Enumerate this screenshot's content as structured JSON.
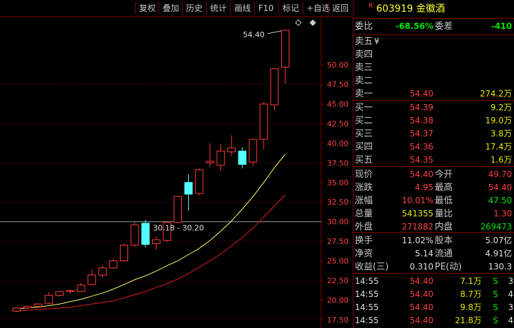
{
  "toolbar": {
    "buttons": [
      "复权",
      "叠加",
      "历史",
      "统计",
      "画线",
      "F10",
      "标记",
      "+自选",
      "返回"
    ]
  },
  "colors": {
    "up": "#ff3b3b",
    "down": "#54ffff",
    "ma_short": "#ffff66",
    "ma_long": "#e02020",
    "grid": "#800000",
    "axis_text": "#ff4040"
  },
  "chart_data": {
    "type": "candlestick",
    "y_ticks": [
      "50.00",
      "47.50",
      "45.00",
      "42.50",
      "40.00",
      "37.50",
      "35.00",
      "32.50",
      "30.00",
      "27.50",
      "25.00",
      "22.50",
      "20.00",
      "17.50"
    ],
    "ylim": [
      17.5,
      55
    ],
    "candles": [
      {
        "o": 18.6,
        "h": 19.1,
        "l": 18.5,
        "c": 19.0
      },
      {
        "o": 19.0,
        "h": 19.3,
        "l": 18.9,
        "c": 19.2
      },
      {
        "o": 19.2,
        "h": 19.6,
        "l": 19.1,
        "c": 19.5
      },
      {
        "o": 19.6,
        "h": 21.0,
        "l": 19.5,
        "c": 20.6
      },
      {
        "o": 20.6,
        "h": 21.2,
        "l": 20.5,
        "c": 21.1
      },
      {
        "o": 21.1,
        "h": 21.4,
        "l": 20.8,
        "c": 21.2
      },
      {
        "o": 21.1,
        "h": 22.2,
        "l": 21.0,
        "c": 21.9
      },
      {
        "o": 22.0,
        "h": 23.9,
        "l": 21.9,
        "c": 23.2
      },
      {
        "o": 23.2,
        "h": 24.4,
        "l": 22.9,
        "c": 24.1
      },
      {
        "o": 24.1,
        "h": 25.3,
        "l": 24.0,
        "c": 25.0
      },
      {
        "o": 25.0,
        "h": 27.2,
        "l": 24.9,
        "c": 27.0
      },
      {
        "o": 27.0,
        "h": 29.9,
        "l": 26.8,
        "c": 29.6
      },
      {
        "o": 29.8,
        "h": 30.2,
        "l": 26.7,
        "c": 27.1
      },
      {
        "o": 27.2,
        "h": 28.1,
        "l": 26.4,
        "c": 27.7
      },
      {
        "o": 27.6,
        "h": 30.0,
        "l": 27.4,
        "c": 29.9
      },
      {
        "o": 29.9,
        "h": 33.3,
        "l": 29.8,
        "c": 33.2
      },
      {
        "o": 35.0,
        "h": 36.0,
        "l": 31.4,
        "c": 33.5
      },
      {
        "o": 33.6,
        "h": 36.8,
        "l": 33.4,
        "c": 36.6
      },
      {
        "o": 37.5,
        "h": 40.0,
        "l": 37.0,
        "c": 37.7
      },
      {
        "o": 37.2,
        "h": 39.9,
        "l": 36.5,
        "c": 39.0
      },
      {
        "o": 38.9,
        "h": 41.0,
        "l": 38.4,
        "c": 39.4
      },
      {
        "o": 39.0,
        "h": 39.5,
        "l": 36.8,
        "c": 37.3
      },
      {
        "o": 37.6,
        "h": 40.6,
        "l": 37.1,
        "c": 40.5
      },
      {
        "o": 40.5,
        "h": 45.3,
        "l": 39.2,
        "c": 45.0
      },
      {
        "o": 44.9,
        "h": 49.6,
        "l": 44.2,
        "c": 49.5
      },
      {
        "o": 49.7,
        "h": 54.4,
        "l": 47.6,
        "c": 54.4
      }
    ],
    "ma5": [
      18.9,
      19.0,
      19.1,
      19.3,
      19.5,
      19.8,
      20.1,
      20.5,
      20.9,
      21.4,
      22.0,
      22.6,
      23.1,
      23.7,
      24.4,
      25.0,
      25.8,
      26.6,
      27.6,
      28.8,
      30.1,
      31.6,
      33.2,
      35.0,
      36.9,
      38.6
    ],
    "ma10": [
      18.6,
      18.7,
      18.8,
      18.9,
      19.0,
      19.1,
      19.3,
      19.5,
      19.7,
      19.9,
      20.3,
      20.7,
      21.1,
      21.6,
      22.1,
      22.7,
      23.4,
      24.2,
      25.0,
      25.9,
      26.9,
      28.0,
      29.2,
      30.6,
      32.0,
      33.4
    ],
    "ref_line": 30.0,
    "ref_label": "30.18 - 30.20",
    "max_label": "54.40"
  },
  "quote": {
    "badge": "R",
    "code_name": "603919 金徽酒",
    "webi_label": "委比",
    "webi_value": "-68.56%",
    "weicha_label": "委差",
    "weicha_value": "-410",
    "sell": [
      {
        "label": "卖五",
        "price": "",
        "vol": "",
        "extra": "¥"
      },
      {
        "label": "卖四",
        "price": "",
        "vol": ""
      },
      {
        "label": "卖三",
        "price": "",
        "vol": ""
      },
      {
        "label": "卖二",
        "price": "",
        "vol": ""
      },
      {
        "label": "卖一",
        "price": "54.40",
        "vol": "274.2万"
      }
    ],
    "buy": [
      {
        "label": "买一",
        "price": "54.39",
        "vol": "9.2万"
      },
      {
        "label": "买二",
        "price": "54.38",
        "vol": "19.0万"
      },
      {
        "label": "买三",
        "price": "54.37",
        "vol": "3.8万"
      },
      {
        "label": "买四",
        "price": "54.36",
        "vol": "17.4万"
      },
      {
        "label": "买五",
        "price": "54.35",
        "vol": "1.6万"
      }
    ],
    "stats": [
      {
        "l1": "现价",
        "v1": "54.40",
        "c1": "red",
        "l2": "今开",
        "v2": "49.70",
        "c2": "red"
      },
      {
        "l1": "涨跌",
        "v1": "4.95",
        "c1": "red",
        "l2": "最高",
        "v2": "54.40",
        "c2": "red"
      },
      {
        "l1": "涨幅",
        "v1": "10.01%",
        "c1": "red",
        "l2": "最低",
        "v2": "47.50",
        "c2": "green"
      },
      {
        "l1": "总量",
        "v1": "541355",
        "c1": "yellow",
        "l2": "量比",
        "v2": "1.30",
        "c2": "red"
      },
      {
        "l1": "外盘",
        "v1": "271882",
        "c1": "red",
        "l2": "内盘",
        "v2": "269473",
        "c2": "green"
      }
    ],
    "fund": [
      {
        "l1": "换手",
        "v1": "11.02%",
        "l2": "股本",
        "v2": "5.07亿"
      },
      {
        "l1": "净资",
        "v1": "5.14",
        "l2": "流通",
        "v2": "4.91亿"
      },
      {
        "l1": "收益(三)",
        "v1": "0.310",
        "l2": "PE(动)",
        "v2": "130.3"
      }
    ],
    "ticks": [
      {
        "time": "14:55",
        "price": "54.40",
        "vol": "7.1万",
        "side": "S",
        "n": "3"
      },
      {
        "time": "14:55",
        "price": "54.40",
        "vol": "8.7万",
        "side": "S",
        "n": "4"
      },
      {
        "time": "14:55",
        "price": "54.40",
        "vol": "9.8万",
        "side": "S",
        "n": "3"
      },
      {
        "time": "14:55",
        "price": "54.40",
        "vol": "21.8万",
        "side": "S",
        "n": "4"
      }
    ]
  }
}
